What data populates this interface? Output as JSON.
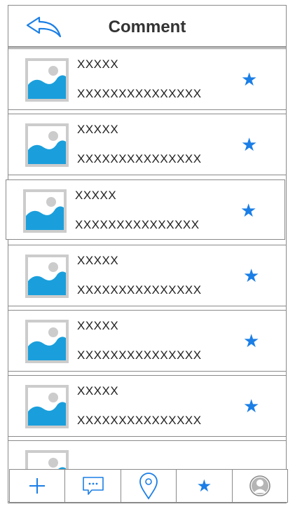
{
  "header": {
    "title": "Comment",
    "back_icon": "back-arrow-icon"
  },
  "items": [
    {
      "name": "XXXXX",
      "sub": "XXXXXXXXXXXXXXX",
      "icon": "image-placeholder-icon"
    },
    {
      "name": "XXXXX",
      "sub": "XXXXXXXXXXXXXXX",
      "icon": "image-placeholder-icon"
    },
    {
      "name": "XXXXX",
      "sub": "XXXXXXXXXXXXXXX",
      "icon": "image-placeholder-icon",
      "selected": true
    },
    {
      "name": "XXXXX",
      "sub": "XXXXXXXXXXXXXXX",
      "icon": "image-placeholder-icon"
    },
    {
      "name": "XXXXX",
      "sub": "XXXXXXXXXXXXXXX",
      "icon": "image-placeholder-icon"
    },
    {
      "name": "XXXXX",
      "sub": "XXXXXXXXXXXXXXX",
      "icon": "image-placeholder-icon"
    },
    {
      "name": "",
      "sub": "",
      "icon": "image-placeholder-icon"
    }
  ],
  "star_glyph": "★",
  "tabs": [
    {
      "icon": "plus-icon"
    },
    {
      "icon": "chat-icon"
    },
    {
      "icon": "map-pin-icon"
    },
    {
      "icon": "star-icon"
    },
    {
      "icon": "user-icon"
    }
  ],
  "colors": {
    "accent": "#1a7ee6",
    "border": "#8a8a8a",
    "placeholder_bg": "#cccccc",
    "placeholder_sky": "#ffffff",
    "placeholder_hill": "#1a9fdc"
  }
}
